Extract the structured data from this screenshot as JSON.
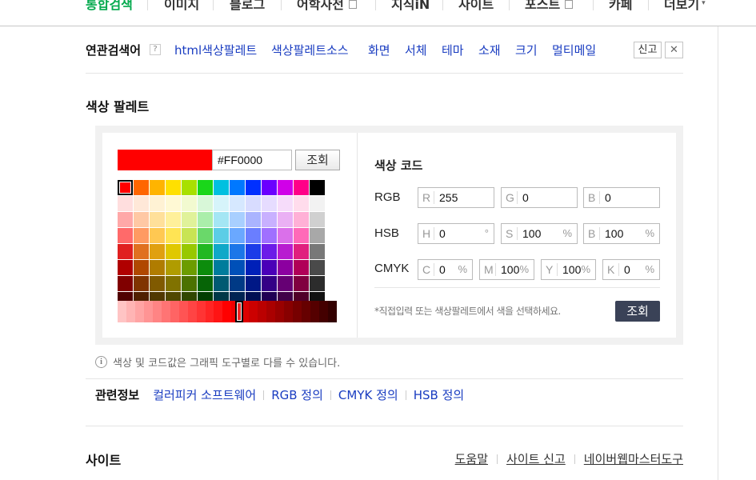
{
  "tabs": [
    {
      "label": "통합검색",
      "active": true,
      "external": false
    },
    {
      "label": "이미지",
      "active": false,
      "external": false
    },
    {
      "label": "블로그",
      "active": false,
      "external": false
    },
    {
      "label": "어학사전",
      "active": false,
      "external": true
    },
    {
      "label": "지식iN",
      "active": false,
      "external": false
    },
    {
      "label": "사이트",
      "active": false,
      "external": false
    },
    {
      "label": "포스트",
      "active": false,
      "external": true
    },
    {
      "label": "카페",
      "active": false,
      "external": false
    },
    {
      "label": "더보기",
      "active": false,
      "external": false,
      "caret": "▾"
    }
  ],
  "related_keywords": {
    "title": "연관검색어",
    "help": "?",
    "items": [
      "html색상팔레트",
      "색상팔레트소스",
      "화면",
      "서체",
      "테마",
      "소재",
      "크기",
      "멀티메일"
    ],
    "report": "신고",
    "close": "✕"
  },
  "section_title": "색상 팔레트",
  "palette": {
    "selected_color": "#FF0000",
    "hex_value": "#FF0000",
    "lookup_button": "조회",
    "grid_colors": [
      [
        "#ff0000",
        "#ff6600",
        "#ffb400",
        "#ffe000",
        "#a8e000",
        "#1ad61a",
        "#00c0e0",
        "#0078ff",
        "#0030ff",
        "#6a00ff",
        "#d000e8",
        "#ff0088",
        "#000000"
      ],
      [
        "#ffdede",
        "#ffe8d8",
        "#fff2d4",
        "#fff9d4",
        "#f2fad0",
        "#d8f7d8",
        "#d6f4fa",
        "#d6e8ff",
        "#d8dcff",
        "#e6dcff",
        "#f6dcfa",
        "#ffdcec",
        "#f2f2f2"
      ],
      [
        "#ffa8a8",
        "#ffc8a4",
        "#ffe09a",
        "#fff09a",
        "#e0f29a",
        "#aaeeaa",
        "#a4e6f4",
        "#a8cfff",
        "#aab4ff",
        "#c8b0ff",
        "#eab0f4",
        "#ffb0d6",
        "#d0d0d0"
      ],
      [
        "#ff6a6a",
        "#ff9a62",
        "#ffc852",
        "#ffe454",
        "#c8e454",
        "#6ad86a",
        "#5ccde6",
        "#6aa8ff",
        "#6a7eff",
        "#a070ff",
        "#da70ea",
        "#ff6ab8",
        "#a8a8a8"
      ],
      [
        "#e02020",
        "#e07020",
        "#e0a010",
        "#e0c800",
        "#98c800",
        "#22b822",
        "#10a8c8",
        "#1c76e8",
        "#1c3ce8",
        "#6c1ce8",
        "#b81cd0",
        "#e0207e",
        "#787878"
      ],
      [
        "#b00000",
        "#b04800",
        "#b07c00",
        "#b09c00",
        "#6c9c00",
        "#0c8c0c",
        "#007c9c",
        "#0050b8",
        "#0020b8",
        "#4a00b8",
        "#8c00a0",
        "#b00058",
        "#4a4a4a"
      ],
      [
        "#800000",
        "#803400",
        "#805a00",
        "#807200",
        "#4c7200",
        "#066406",
        "#005a72",
        "#003a86",
        "#001886",
        "#340086",
        "#660074",
        "#800040",
        "#2c2c2c"
      ],
      [
        "#500000",
        "#502000",
        "#503800",
        "#504800",
        "#304800",
        "#023e02",
        "#003848",
        "#002454",
        "#000e54",
        "#200054",
        "#400048",
        "#500028",
        "#111111"
      ]
    ],
    "shades": [
      "#ffc4c4",
      "#ffb4b4",
      "#ffa4a4",
      "#ff9494",
      "#ff8484",
      "#ff7474",
      "#ff6464",
      "#ff5454",
      "#ff4444",
      "#ff3434",
      "#ff2424",
      "#ff1414",
      "#ff0000",
      "#ee0000",
      "#dd0000",
      "#cc0000",
      "#bb0000",
      "#aa0000",
      "#990000",
      "#880000",
      "#770000",
      "#660000",
      "#550000",
      "#440000",
      "#330000"
    ],
    "shade_selected_index": 12
  },
  "code": {
    "title": "색상 코드",
    "rgb": {
      "label": "RGB",
      "fields": [
        {
          "pre": "R",
          "value": "255",
          "unit": ""
        },
        {
          "pre": "G",
          "value": "0",
          "unit": ""
        },
        {
          "pre": "B",
          "value": "0",
          "unit": ""
        }
      ]
    },
    "hsb": {
      "label": "HSB",
      "fields": [
        {
          "pre": "H",
          "value": "0",
          "unit": "°"
        },
        {
          "pre": "S",
          "value": "100",
          "unit": "%"
        },
        {
          "pre": "B",
          "value": "100",
          "unit": "%"
        }
      ]
    },
    "cmyk": {
      "label": "CMYK",
      "fields": [
        {
          "pre": "C",
          "value": "0",
          "unit": "%"
        },
        {
          "pre": "M",
          "value": "100",
          "unit": "%"
        },
        {
          "pre": "Y",
          "value": "100",
          "unit": "%"
        },
        {
          "pre": "K",
          "value": "0",
          "unit": "%"
        }
      ]
    },
    "note": "*직접입력 또는 색상팔레트에서 색을 선택하세요.",
    "lookup_button": "조회"
  },
  "info": {
    "icon": "i",
    "text": "색상 및 코드값은 그래픽 도구별로 다를 수 있습니다."
  },
  "related_info": {
    "title": "관련정보",
    "links": [
      "컬러피커 소프트웨어",
      "RGB 정의",
      "CMYK 정의",
      "HSB 정의"
    ]
  },
  "footer": {
    "title": "사이트",
    "links": [
      "도움말",
      "사이트 신고",
      "네이버웹마스터도구"
    ]
  },
  "colors": {
    "accent_green": "#03a94d",
    "link_blue": "#1a3dc1",
    "dark_button": "#3a4257"
  }
}
